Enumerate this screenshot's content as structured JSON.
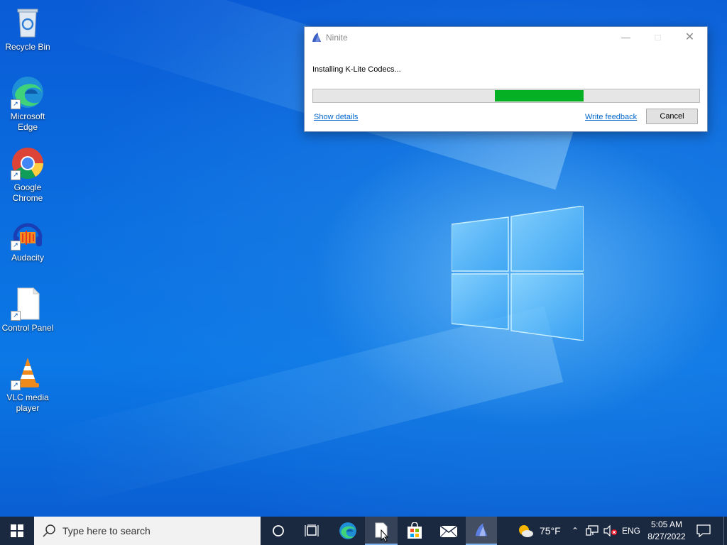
{
  "desktop": {
    "icons": [
      {
        "label": "Recycle Bin",
        "icon": "recycle-bin-icon"
      },
      {
        "label": "Microsoft Edge",
        "icon": "edge-icon"
      },
      {
        "label": "Google Chrome",
        "icon": "chrome-icon"
      },
      {
        "label": "Audacity",
        "icon": "audacity-icon"
      },
      {
        "label": "Control Panel",
        "icon": "document-icon"
      },
      {
        "label": "VLC media player",
        "icon": "vlc-icon"
      }
    ]
  },
  "ninite_window": {
    "title": "Ninite",
    "status": "Installing K-Lite Codecs...",
    "progress": {
      "start": 0.47,
      "end": 0.7,
      "color": "#06b025"
    },
    "show_details": "Show details",
    "write_feedback": "Write feedback",
    "cancel": "Cancel"
  },
  "taskbar": {
    "search_placeholder": "Type here to search",
    "weather_temp": "75°F",
    "language": "ENG",
    "time": "5:05 AM",
    "date": "8/27/2022"
  },
  "colors": {
    "taskbar": "#1a2840",
    "progress_fill": "#06b025",
    "link": "#0066cc"
  }
}
